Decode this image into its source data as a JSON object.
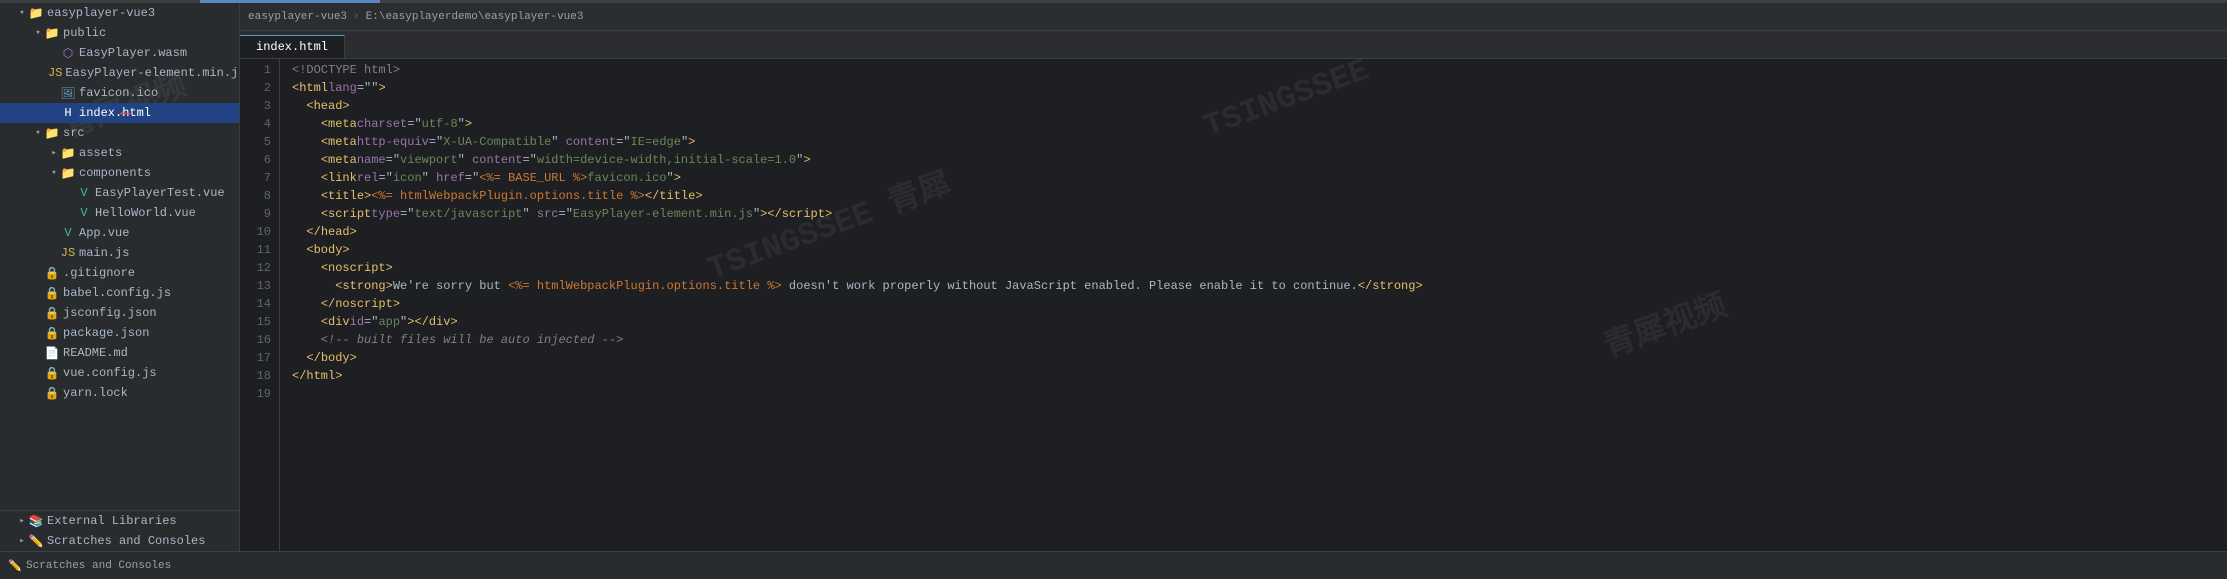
{
  "topbar": {
    "project_path": "easyplayer-vue3",
    "path_separator": "›",
    "path_parts": [
      "E:\\easyplayerdemo\\easyplayer-vue3"
    ]
  },
  "sidebar": {
    "project_name": "easyplayer-vue3",
    "tree": [
      {
        "id": "root",
        "label": "easyplayer-vue3",
        "type": "folder",
        "level": 0,
        "expanded": true,
        "arrow": "down"
      },
      {
        "id": "public",
        "label": "public",
        "type": "folder",
        "level": 1,
        "expanded": true,
        "arrow": "down"
      },
      {
        "id": "easywasm",
        "label": "EasyPlayer.wasm",
        "type": "wasm",
        "level": 2
      },
      {
        "id": "easyjs",
        "label": "EasyPlayer-element.min.js",
        "type": "js",
        "level": 2
      },
      {
        "id": "favicon",
        "label": "favicon.ico",
        "type": "ico",
        "level": 2
      },
      {
        "id": "indexhtml",
        "label": "index.html",
        "type": "html",
        "level": 2,
        "selected": true
      },
      {
        "id": "src",
        "label": "src",
        "type": "folder",
        "level": 1,
        "expanded": true,
        "arrow": "down"
      },
      {
        "id": "assets",
        "label": "assets",
        "type": "folder",
        "level": 2,
        "expanded": false,
        "arrow": "right"
      },
      {
        "id": "components",
        "label": "components",
        "type": "folder",
        "level": 2,
        "expanded": true,
        "arrow": "down"
      },
      {
        "id": "easyplayertest",
        "label": "EasyPlayerTest.vue",
        "type": "vue",
        "level": 3
      },
      {
        "id": "helloworld",
        "label": "HelloWorld.vue",
        "type": "vue",
        "level": 3
      },
      {
        "id": "appvue",
        "label": "App.vue",
        "type": "vue",
        "level": 2
      },
      {
        "id": "mainjs",
        "label": "main.js",
        "type": "js",
        "level": 2
      },
      {
        "id": "gitignore",
        "label": ".gitignore",
        "type": "git",
        "level": 1
      },
      {
        "id": "babelconfig",
        "label": "babel.config.js",
        "type": "js",
        "level": 1
      },
      {
        "id": "jsconfig",
        "label": "jsconfig.json",
        "type": "json",
        "level": 1
      },
      {
        "id": "packagejson",
        "label": "package.json",
        "type": "json",
        "level": 1
      },
      {
        "id": "readme",
        "label": "README.md",
        "type": "md",
        "level": 1
      },
      {
        "id": "vueconfig",
        "label": "vue.config.js",
        "type": "js",
        "level": 1
      },
      {
        "id": "yarnlock",
        "label": "yarn.lock",
        "type": "lock",
        "level": 1
      },
      {
        "id": "extlibs",
        "label": "External Libraries",
        "type": "lib",
        "level": 0
      },
      {
        "id": "scratches",
        "label": "Scratches and Consoles",
        "type": "scratch",
        "level": 0
      }
    ]
  },
  "editor": {
    "tab_label": "index.html",
    "lines": [
      {
        "num": 1,
        "content": "<!DOCTYPE html>"
      },
      {
        "num": 2,
        "content": "<html lang=\"\">"
      },
      {
        "num": 3,
        "content": "  <head>"
      },
      {
        "num": 4,
        "content": "    <meta charset=\"utf-8\">"
      },
      {
        "num": 5,
        "content": "    <meta http-equiv=\"X-UA-Compatible\" content=\"IE=edge\">"
      },
      {
        "num": 6,
        "content": "    <meta name=\"viewport\" content=\"width=device-width,initial-scale=1.0\">"
      },
      {
        "num": 7,
        "content": "    <link rel=\"icon\" href=\"<%= BASE_URL %>favicon.ico\">"
      },
      {
        "num": 8,
        "content": "    <title><%= htmlWebpackPlugin.options.title %></title>"
      },
      {
        "num": 9,
        "content": "    <script type=\"text/javascript\" src=\"EasyPlayer-element.min.js\"><\\/script>"
      },
      {
        "num": 10,
        "content": "  </head>"
      },
      {
        "num": 11,
        "content": "  <body>"
      },
      {
        "num": 12,
        "content": "    <noscript>"
      },
      {
        "num": 13,
        "content": "      <strong>We're sorry but <%= htmlWebpackPlugin.options.title %> doesn't work properly without JavaScript enabled. Please enable it to continue.</strong>"
      },
      {
        "num": 14,
        "content": "    </noscript>"
      },
      {
        "num": 15,
        "content": "    <div id=\"app\"></div>"
      },
      {
        "num": 16,
        "content": "    <!-- built files will be auto injected -->"
      },
      {
        "num": 17,
        "content": "  </body>"
      },
      {
        "num": 18,
        "content": "</html>"
      },
      {
        "num": 19,
        "content": ""
      }
    ]
  },
  "bottom_bar": {
    "scratches_label": "Scratches and Consoles"
  },
  "scrollbar": {
    "visible": true
  }
}
